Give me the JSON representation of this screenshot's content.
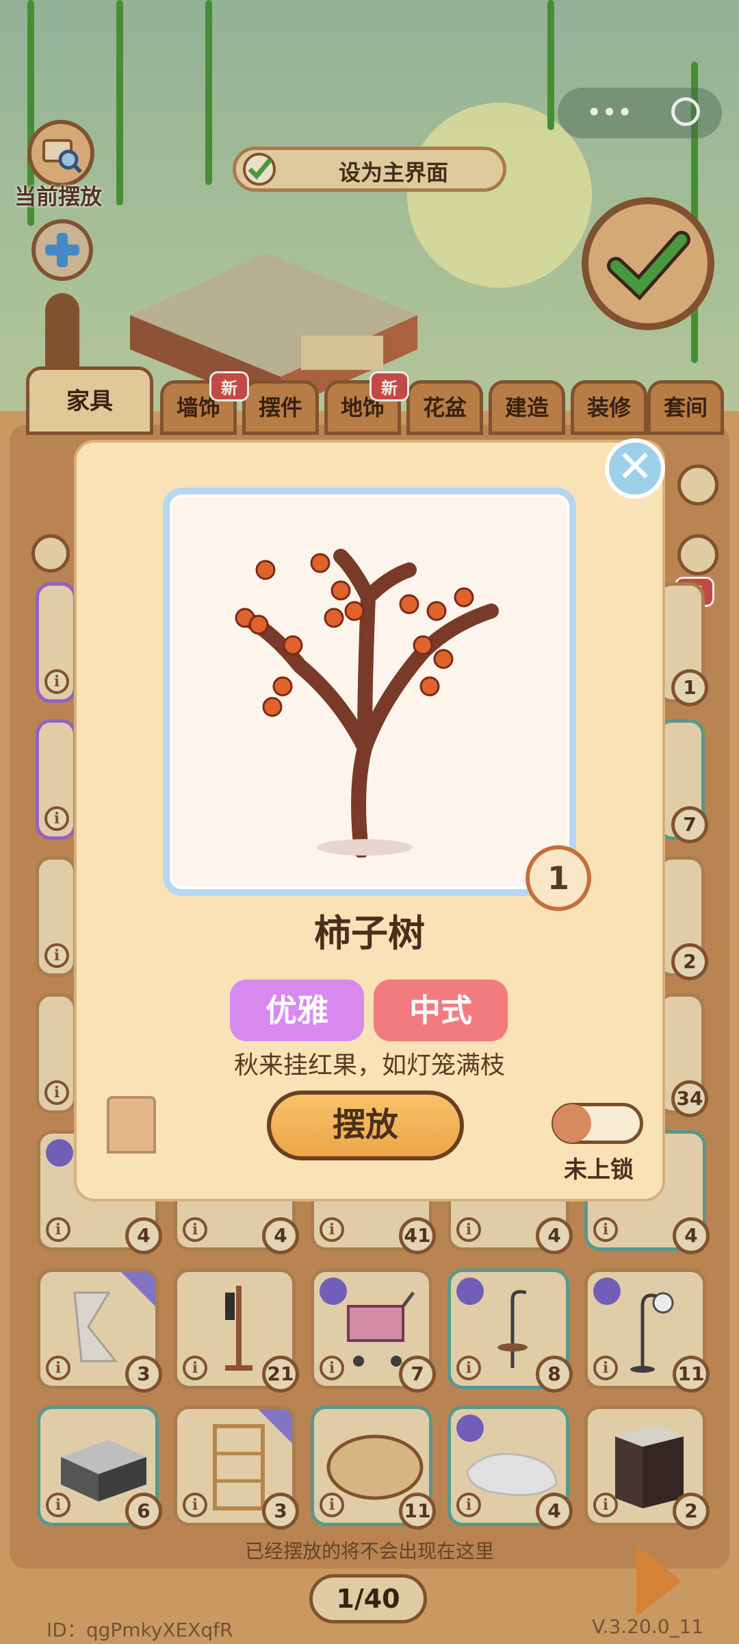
{
  "top": {
    "current_placed_label": "当前摆放",
    "set_main_label": "设为主界面"
  },
  "tabs": [
    {
      "label": "家具",
      "active": true,
      "new": false
    },
    {
      "label": "墙饰",
      "active": false,
      "new": true
    },
    {
      "label": "摆件",
      "active": false,
      "new": false
    },
    {
      "label": "地饰",
      "active": false,
      "new": true
    },
    {
      "label": "花盆",
      "active": false,
      "new": false
    },
    {
      "label": "建造",
      "active": false,
      "new": false
    },
    {
      "label": "装修",
      "active": false,
      "new": false
    },
    {
      "label": "套间",
      "active": false,
      "new": false
    }
  ],
  "new_badge": "新",
  "info_glyph": "i",
  "side_items": {
    "right_counts": [
      "1",
      "7",
      "2",
      "34",
      "4"
    ],
    "row5_counts": [
      "4",
      "4",
      "41",
      "4"
    ]
  },
  "grid": {
    "row1": [
      {
        "name": "curved-panel",
        "count": "3"
      },
      {
        "name": "coat-rack",
        "count": "21"
      },
      {
        "name": "shopping-cart",
        "count": "7"
      },
      {
        "name": "side-table-lamp",
        "count": "8"
      },
      {
        "name": "floor-lamp",
        "count": "11"
      }
    ],
    "row2": [
      {
        "name": "sink-cabinet",
        "count": "6"
      },
      {
        "name": "shelf",
        "count": "3"
      },
      {
        "name": "round-mat",
        "count": "11"
      },
      {
        "name": "cat-cushion",
        "count": "4"
      },
      {
        "name": "cabinet",
        "count": "2"
      }
    ]
  },
  "footer": {
    "notice": "已经摆放的将不会出现在这里",
    "page": "1/40",
    "user_id": "ID：qgPmkyXEXqfR",
    "version": "V.3.20.0_11"
  },
  "modal": {
    "item_name": "柿子树",
    "quantity": "1",
    "tags": [
      {
        "label": "优雅",
        "color": "#d889f0"
      },
      {
        "label": "中式",
        "color": "#f27b7f"
      }
    ],
    "description": "秋来挂红果，如灯笼满枝",
    "place_label": "摆放",
    "lock_label": "未上锁",
    "close_glyph": "✕"
  },
  "colors": {
    "accent_orange": "#eda548",
    "panel_brown": "#dba66a",
    "frame_blue": "#b7d6f3"
  }
}
